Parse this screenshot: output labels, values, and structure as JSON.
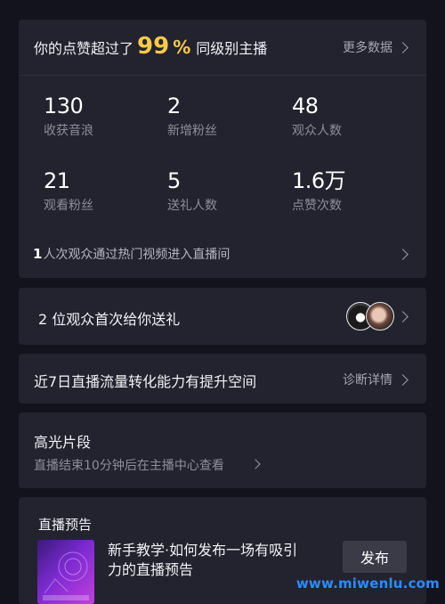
{
  "summary": {
    "prefix": "你的点赞超过了",
    "percent": "99",
    "percent_sign": "%",
    "suffix": "同级别主播",
    "more_label": "更多数据"
  },
  "stats": [
    {
      "value": "130",
      "label": "收获音浪"
    },
    {
      "value": "2",
      "label": "新增粉丝"
    },
    {
      "value": "48",
      "label": "观众人数"
    },
    {
      "value": "21",
      "label": "观看粉丝"
    },
    {
      "value": "5",
      "label": "送礼人数"
    },
    {
      "value": "1.6万",
      "label": "点赞次数"
    }
  ],
  "hot_video": {
    "count": "1",
    "text": "人次观众通过热门视频进入直播间"
  },
  "gift": {
    "count": "2",
    "text": "位观众首次给你送礼"
  },
  "traffic": {
    "text": "近7日直播流量转化能力有提升空间",
    "link": "诊断详情"
  },
  "highlight": {
    "title": "高光片段",
    "subtitle": "直播结束10分钟后在主播中心查看"
  },
  "preview": {
    "title": "直播预告",
    "line1": "新手教学·如何发布一场有吸引",
    "line2": "力的直播预告",
    "button": "发布"
  },
  "watermark": "www.miwenlu.com",
  "colors": {
    "background": "#13131d",
    "card": "#23232f",
    "accent": "#f7c948",
    "watermark": "#2a8cff"
  }
}
